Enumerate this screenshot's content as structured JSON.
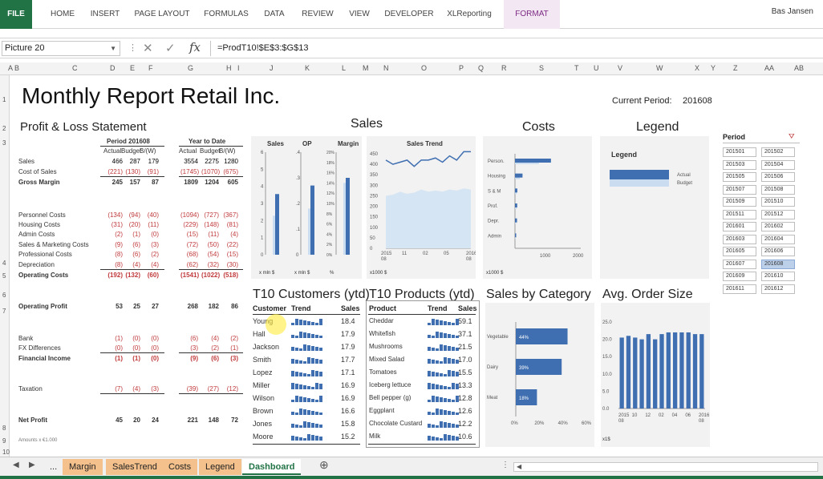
{
  "ribbon": {
    "tabs": [
      "FILE",
      "HOME",
      "INSERT",
      "PAGE LAYOUT",
      "FORMULAS",
      "DATA",
      "REVIEW",
      "VIEW",
      "DEVELOPER",
      "XLReporting",
      "FORMAT"
    ],
    "user": "Bas Jansen"
  },
  "formula_bar": {
    "name_box": "Picture 20",
    "formula": "=ProdT10!$E$3:$G$13",
    "fx": "fx"
  },
  "columns": [
    "A",
    "B",
    "C",
    "D",
    "E",
    "F",
    "G",
    "H",
    "I",
    "J",
    "K",
    "L",
    "M",
    "N",
    "O",
    "P",
    "Q",
    "R",
    "S",
    "T",
    "U",
    "V",
    "W",
    "X",
    "Y",
    "Z",
    "AA",
    "AB"
  ],
  "rows": [
    "1",
    "2",
    "3",
    "4",
    "5",
    "6",
    "7",
    "8",
    "9",
    "10"
  ],
  "title": "Monthly Report Retail Inc.",
  "current_period": {
    "label": "Current Period:",
    "value": "201608"
  },
  "sections": {
    "pl": "Profit & Loss Statement",
    "sales": "Sales",
    "costs": "Costs",
    "legend": "Legend",
    "t10cust": "T10 Customers (ytd)",
    "t10prod": "T10 Products (ytd)",
    "salescat": "Sales by Category",
    "aos": "Avg. Order Size"
  },
  "pl": {
    "period_header": "Period 201608",
    "ytd_header": "Year to Date",
    "col_heads": [
      "Actual",
      "Budget",
      "B/(W)",
      "Actual",
      "Budget",
      "B/(W)"
    ],
    "rows": [
      {
        "label": "Sales",
        "vals": [
          "466",
          "287",
          "179",
          "3554",
          "2275",
          "1280"
        ],
        "style": "normal"
      },
      {
        "label": "Cost of Sales",
        "vals": [
          "(221)",
          "(130)",
          "(91)",
          "(1745)",
          "(1070)",
          "(675)"
        ],
        "style": "red"
      },
      {
        "label": "Gross Margin",
        "vals": [
          "245",
          "157",
          "87",
          "1809",
          "1204",
          "605"
        ],
        "style": "bold"
      },
      {
        "label": "Personnel Costs",
        "vals": [
          "(134)",
          "(94)",
          "(40)",
          "(1094)",
          "(727)",
          "(367)"
        ],
        "style": "red"
      },
      {
        "label": "Housing Costs",
        "vals": [
          "(31)",
          "(20)",
          "(11)",
          "(229)",
          "(148)",
          "(81)"
        ],
        "style": "red"
      },
      {
        "label": "Admin Costs",
        "vals": [
          "(2)",
          "(1)",
          "(0)",
          "(15)",
          "(11)",
          "(4)"
        ],
        "style": "red"
      },
      {
        "label": "Sales & Marketing Costs",
        "vals": [
          "(9)",
          "(6)",
          "(3)",
          "(72)",
          "(50)",
          "(22)"
        ],
        "style": "red"
      },
      {
        "label": "Professional Costs",
        "vals": [
          "(8)",
          "(6)",
          "(2)",
          "(68)",
          "(54)",
          "(15)"
        ],
        "style": "red"
      },
      {
        "label": "Depreciation",
        "vals": [
          "(8)",
          "(4)",
          "(4)",
          "(62)",
          "(32)",
          "(30)"
        ],
        "style": "red"
      },
      {
        "label": "Operating Costs",
        "vals": [
          "(192)",
          "(132)",
          "(60)",
          "(1541)",
          "(1022)",
          "(518)"
        ],
        "style": "redbold"
      },
      {
        "label": "Operating Profit",
        "vals": [
          "53",
          "25",
          "27",
          "268",
          "182",
          "86"
        ],
        "style": "bold"
      },
      {
        "label": "Bank",
        "vals": [
          "(1)",
          "(0)",
          "(0)",
          "(6)",
          "(4)",
          "(2)"
        ],
        "style": "red"
      },
      {
        "label": "FX Differences",
        "vals": [
          "(0)",
          "(0)",
          "(0)",
          "(3)",
          "(2)",
          "(1)"
        ],
        "style": "red"
      },
      {
        "label": "Financial Income",
        "vals": [
          "(1)",
          "(1)",
          "(0)",
          "(9)",
          "(6)",
          "(3)"
        ],
        "style": "redbold"
      },
      {
        "label": "Taxation",
        "vals": [
          "(7)",
          "(4)",
          "(3)",
          "(39)",
          "(27)",
          "(12)"
        ],
        "style": "red"
      },
      {
        "label": "Net Profit",
        "vals": [
          "45",
          "20",
          "24",
          "221",
          "148",
          "72"
        ],
        "style": "bold"
      }
    ],
    "footnote": "Amounts x €1.000"
  },
  "sales_panel": {
    "heads": [
      "Sales",
      "OP",
      "Margin"
    ],
    "sales_ticks": [
      "6",
      "5",
      "4",
      "3",
      "2",
      "1",
      "0"
    ],
    "op_ticks": [
      ".4",
      ".3",
      ".2",
      ".1",
      "0"
    ],
    "margin_ticks": [
      "20%",
      "18%",
      "16%",
      "14%",
      "12%",
      "10%",
      "8%",
      "6%",
      "4%",
      "2%",
      "0%"
    ],
    "units": [
      "x mln $",
      "x mln $",
      "%"
    ]
  },
  "sales_trend": {
    "title": "Sales Trend",
    "y_ticks": [
      "450",
      "400",
      "350",
      "300",
      "250",
      "200",
      "150",
      "100",
      "50",
      "0"
    ],
    "x_ticks": [
      "2015\n08",
      "11",
      "02",
      "05",
      "2016\n08"
    ],
    "unit": "x1000 $"
  },
  "costs_panel": {
    "categories": [
      "Person.",
      "Housing",
      "S & M",
      "Prof.",
      "Depr.",
      "Admin"
    ],
    "x_ticks": [
      "1000",
      "2000"
    ],
    "unit": "x1000 $"
  },
  "legend_panel": {
    "title": "Legend",
    "actual": "Actual",
    "budget": "Budget"
  },
  "slicer": {
    "title": "Period",
    "items": [
      "201501",
      "201502",
      "201503",
      "201504",
      "201505",
      "201506",
      "201507",
      "201508",
      "201509",
      "201510",
      "201511",
      "201512",
      "201601",
      "201602",
      "201603",
      "201604",
      "201605",
      "201606",
      "201607",
      "201608",
      "201609",
      "201610",
      "201611",
      "201612"
    ],
    "selected": "201608"
  },
  "t10_customers": {
    "heads": [
      "Customer",
      "Trend",
      "Sales"
    ],
    "rows": [
      {
        "name": "Young",
        "sales": "18.4"
      },
      {
        "name": "Hall",
        "sales": "17.9"
      },
      {
        "name": "Jackson",
        "sales": "17.9"
      },
      {
        "name": "Smith",
        "sales": "17.7"
      },
      {
        "name": "Lopez",
        "sales": "17.1"
      },
      {
        "name": "Miller",
        "sales": "16.9"
      },
      {
        "name": "Wilson",
        "sales": "16.9"
      },
      {
        "name": "Brown",
        "sales": "16.6"
      },
      {
        "name": "Jones",
        "sales": "15.8"
      },
      {
        "name": "Moore",
        "sales": "15.2"
      }
    ]
  },
  "t10_products": {
    "heads": [
      "Product",
      "Trend",
      "Sales"
    ],
    "rows": [
      {
        "name": "Cheddar",
        "sales": "59.1"
      },
      {
        "name": "Whitefish",
        "sales": "37.1"
      },
      {
        "name": "Mushrooms",
        "sales": "21.5"
      },
      {
        "name": "Mixed Salad",
        "sales": "17.0"
      },
      {
        "name": "Tomatoes",
        "sales": "15.5"
      },
      {
        "name": "Iceberg lettuce",
        "sales": "13.3"
      },
      {
        "name": "Bell pepper (g)",
        "sales": "12.8"
      },
      {
        "name": "Eggplant",
        "sales": "12.6"
      },
      {
        "name": "Chocolate Custard",
        "sales": "12.2"
      },
      {
        "name": "Milk",
        "sales": "10.6"
      }
    ]
  },
  "sales_by_category": {
    "categories": [
      "Vegetable",
      "Dairy",
      "Meat"
    ],
    "labels": [
      "44%",
      "39%",
      "18%"
    ],
    "x_ticks": [
      "0%",
      "20%",
      "40%",
      "60%"
    ]
  },
  "aos": {
    "y_ticks": [
      "25.0",
      "20.0",
      "15.0",
      "10.0",
      "5.0",
      "0.0"
    ],
    "x_ticks": [
      "2015\n08",
      "10",
      "12",
      "02",
      "04",
      "06",
      "2016\n08"
    ],
    "unit": "x1$"
  },
  "sheet_tabs": [
    "...",
    "Margin",
    "SalesTrend",
    "Costs",
    "Legend",
    "Dashboard"
  ],
  "active_tab": "Dashboard",
  "chart_data": [
    {
      "type": "bar",
      "title": "Sales",
      "categories": [
        "Actual",
        "Budget"
      ],
      "values": [
        3.55,
        2.28
      ],
      "ylim": [
        0,
        6
      ],
      "ylabel": "x mln $"
    },
    {
      "type": "bar",
      "title": "OP",
      "categories": [
        "Actual",
        "Budget"
      ],
      "values": [
        0.27,
        0.18
      ],
      "ylim": [
        0,
        0.4
      ],
      "ylabel": "x mln $"
    },
    {
      "type": "bar",
      "title": "Margin",
      "categories": [
        "Actual",
        "Budget"
      ],
      "values": [
        15,
        14
      ],
      "ylim": [
        0,
        20
      ],
      "ylabel": "%"
    },
    {
      "type": "line",
      "title": "Sales Trend",
      "x": [
        "2015-08",
        "2015-09",
        "2015-10",
        "2015-11",
        "2015-12",
        "2016-01",
        "2016-02",
        "2016-03",
        "2016-04",
        "2016-05",
        "2016-06",
        "2016-07",
        "2016-08"
      ],
      "series": [
        {
          "name": "Actual",
          "values": [
            420,
            400,
            410,
            420,
            390,
            420,
            420,
            430,
            410,
            440,
            420,
            460,
            460
          ]
        },
        {
          "name": "Budget",
          "values": [
            250,
            255,
            270,
            260,
            265,
            280,
            270,
            275,
            270,
            280,
            275,
            285,
            280
          ]
        }
      ],
      "ylim": [
        0,
        450
      ]
    },
    {
      "type": "bar",
      "title": "Costs",
      "categories": [
        "Person.",
        "Housing",
        "S & M",
        "Prof.",
        "Depr.",
        "Admin"
      ],
      "series": [
        {
          "name": "Actual",
          "values": [
            1094,
            229,
            72,
            68,
            62,
            15
          ]
        },
        {
          "name": "Budget",
          "values": [
            727,
            148,
            50,
            54,
            32,
            11
          ]
        }
      ],
      "xlim": [
        0,
        2000
      ]
    },
    {
      "type": "bar",
      "title": "Sales by Category",
      "categories": [
        "Vegetable",
        "Dairy",
        "Meat"
      ],
      "values": [
        44,
        39,
        18
      ],
      "xlim": [
        0,
        60
      ]
    },
    {
      "type": "bar",
      "title": "Avg. Order Size",
      "x": [
        "2015-08",
        "2015-09",
        "2015-10",
        "2015-11",
        "2015-12",
        "2016-01",
        "2016-02",
        "2016-03",
        "2016-04",
        "2016-05",
        "2016-06",
        "2016-07",
        "2016-08"
      ],
      "values": [
        20.5,
        21,
        20.5,
        20,
        21.5,
        20,
        21.5,
        22,
        22,
        22,
        22,
        21.5,
        21.5
      ],
      "ylim": [
        0,
        25
      ]
    }
  ]
}
